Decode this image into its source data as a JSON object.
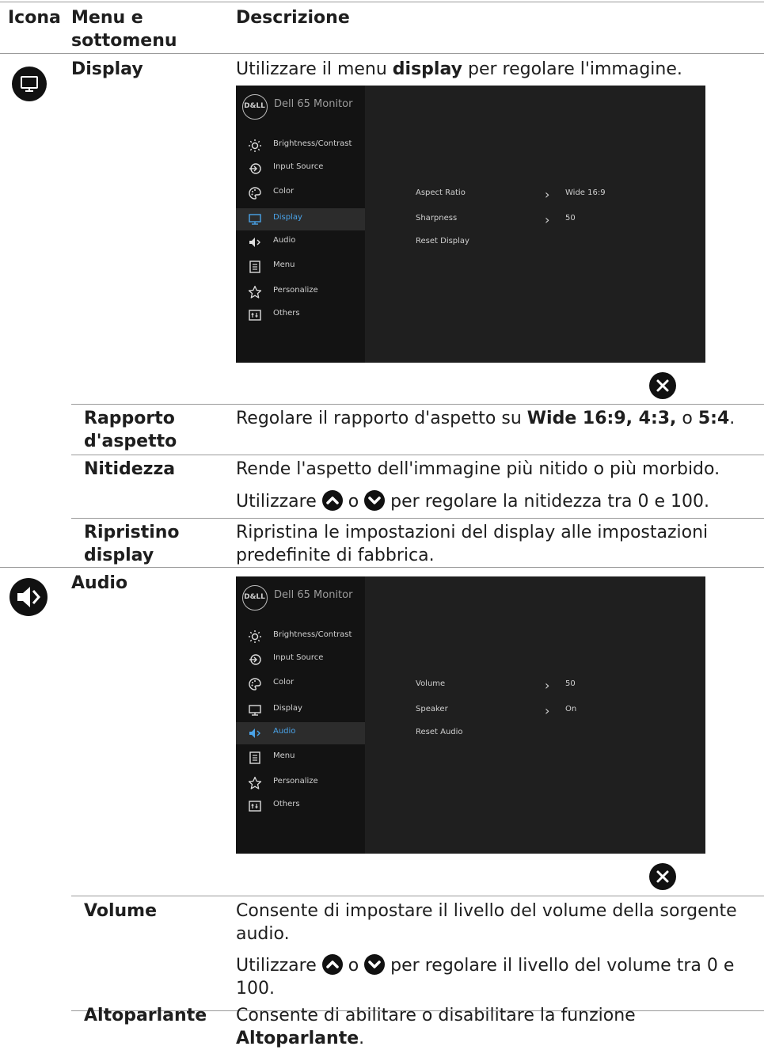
{
  "header": {
    "icon": "Icona",
    "menu": "Menu e sottomenu",
    "desc": "Descrizione"
  },
  "display": {
    "title": "Display",
    "intro_pre": "Utilizzare il menu ",
    "intro_bold": "display",
    "intro_post": " per regolare l'immagine.",
    "osd": {
      "brand": "D&LL",
      "model": "Dell 65 Monitor",
      "menu": [
        "Brightness/Contrast",
        "Input Source",
        "Color",
        "Display",
        "Audio",
        "Menu",
        "Personalize",
        "Others"
      ],
      "active_index": 3,
      "rows": [
        {
          "label": "Aspect Ratio",
          "value": "Wide 16:9"
        },
        {
          "label": "Sharpness",
          "value": "50"
        },
        {
          "label": "Reset Display",
          "value": ""
        }
      ]
    },
    "items": [
      {
        "name": "Rapporto d'aspetto",
        "desc_pre": "Regolare il rapporto d'aspetto su ",
        "b1": "Wide 16:9, 4:3,",
        "mid": " o ",
        "b2": "5:4",
        "end": "."
      },
      {
        "name": "Nitidezza",
        "desc": "Rende l'aspetto dell'immagine più nitido o più morbido.",
        "desc2_pre": "Utilizzare ",
        "desc2_mid": " o ",
        "desc2_post": " per regolare la nitidezza tra 0 e 100."
      },
      {
        "name": "Ripristino display",
        "desc": "Ripristina le impostazioni del display alle impostazioni predefinite di fabbrica."
      }
    ]
  },
  "audio": {
    "title": "Audio",
    "osd": {
      "brand": "D&LL",
      "model": "Dell 65 Monitor",
      "menu": [
        "Brightness/Contrast",
        "Input Source",
        "Color",
        "Display",
        "Audio",
        "Menu",
        "Personalize",
        "Others"
      ],
      "active_index": 4,
      "rows": [
        {
          "label": "Volume",
          "value": "50"
        },
        {
          "label": "Speaker",
          "value": "On"
        },
        {
          "label": "Reset Audio",
          "value": ""
        }
      ]
    },
    "items": [
      {
        "name": "Volume",
        "desc": "Consente di impostare il livello del volume della sorgente audio.",
        "desc2_pre": "Utilizzare ",
        "desc2_mid": " o ",
        "desc2_post": " per regolare il livello del volume tra 0 e 100."
      },
      {
        "name": "Altoparlante",
        "desc_pre": "Consente di abilitare o disabilitare la funzione ",
        "b1": "Altoparlante",
        "end": "."
      }
    ]
  },
  "colors": {
    "active": "#4aa3e8",
    "osd_bg": "#1f1f1f",
    "osd_side": "#131313"
  }
}
